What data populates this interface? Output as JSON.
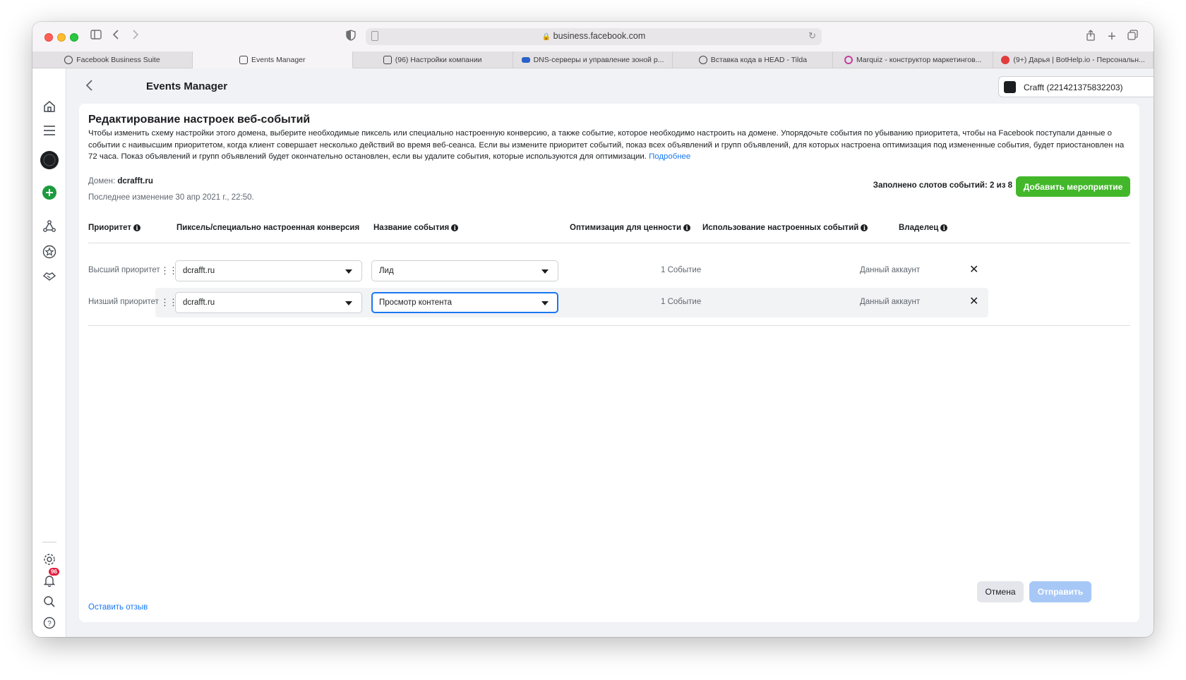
{
  "browser": {
    "url": "business.facebook.com",
    "tabs": [
      {
        "label": "Facebook Business Suite",
        "active": false,
        "icon": "facebook-business-icon"
      },
      {
        "label": "Events Manager",
        "active": true,
        "icon": "events-manager-icon"
      },
      {
        "label": "(96) Настройки компании",
        "active": false,
        "icon": "settings-page-icon"
      },
      {
        "label": "DNS-серверы и управление зоной р...",
        "active": false,
        "icon": "dns-icon"
      },
      {
        "label": "Вставка кода в HEAD - Tilda",
        "active": false,
        "icon": "tilda-icon"
      },
      {
        "label": "Marquiz - конструктор маркетингов...",
        "active": false,
        "icon": "marquiz-icon"
      },
      {
        "label": "(9+) Дарья | BotHelp.io - Персональн...",
        "active": false,
        "icon": "bothelp-icon"
      }
    ]
  },
  "rail": {
    "notifications_badge": "96"
  },
  "header": {
    "title": "Events Manager",
    "account": "Crafft (221421375832203)"
  },
  "card": {
    "title": "Редактирование настроек веб-событий",
    "description": "Чтобы изменить схему настройки этого домена, выберите необходимые пиксель или специально настроенную конверсию, а также событие, которое необходимо настроить на домене. Упорядочьте события по убыванию приоритета, чтобы на Facebook поступали данные о событии с наивысшим приоритетом, когда клиент совершает несколько действий во время веб-сеанса. Если вы измените приоритет событий, показ всех объявлений и групп объявлений, для которых настроена оптимизация под измененные события, будет приостановлен на 72 часа. Показ объявлений и групп объявлений будет окончательно остановлен, если вы удалите события, которые используются для оптимизации.",
    "learn_more": "Подробнее",
    "domain_label": "Домен:",
    "domain_value": "dcrafft.ru",
    "last_modified": "Последнее изменение 30 апр 2021 г., 22:50.",
    "slots": "Заполнено слотов событий: 2 из 8",
    "add_button": "Добавить мероприятие",
    "columns": {
      "priority": "Приоритет",
      "pixel": "Пиксель/специально настроенная конверсия",
      "event_name": "Название события",
      "value_opt": "Оптимизация для ценности",
      "usage": "Использование настроенных событий",
      "owner": "Владелец"
    },
    "rows": [
      {
        "priority": "Высший приоритет",
        "pixel": "dcrafft.ru",
        "event": "Лид",
        "usage": "1 Событие",
        "owner": "Данный аккаунт"
      },
      {
        "priority": "Низший приоритет",
        "pixel": "dcrafft.ru",
        "event": "Просмотр контента",
        "usage": "1 Событие",
        "owner": "Данный аккаунт"
      }
    ],
    "feedback": "Оставить отзыв",
    "cancel": "Отмена",
    "submit": "Отправить"
  },
  "colors": {
    "accent": "#1877f2",
    "add_button": "#42b72a",
    "submit_disabled": "#a7c8f7",
    "badge": "#e41e3f"
  }
}
